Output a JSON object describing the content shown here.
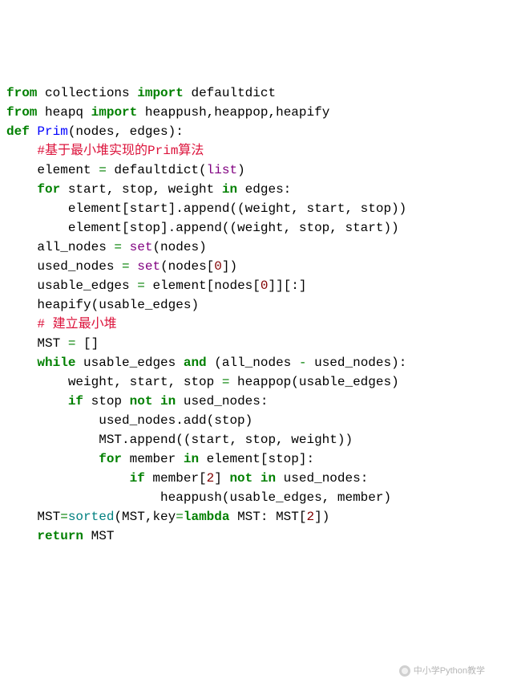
{
  "code": {
    "l1": {
      "from": "from",
      "mod1": "collections",
      "import": "import",
      "name1": "defaultdict"
    },
    "l2": {
      "from": "from",
      "mod2": "heapq",
      "import": "import",
      "names": "heappush,heappop,heapify"
    },
    "l3": {
      "def": "def",
      "fn": "Prim",
      "params": "(nodes, edges):"
    },
    "l4": {
      "cmt": "#基于最小堆实现的Prim算法"
    },
    "l5": {
      "a": "element ",
      "eq": "=",
      "sp": " defaultdict(",
      "bi": "list",
      "c": ")"
    },
    "l6": {
      "for": "for",
      "vars": " start, stop, weight ",
      "in": "in",
      "tail": " edges:"
    },
    "l7": {
      "txt": "element[start].append((weight, start, stop))"
    },
    "l8": {
      "txt": "element[stop].append((weight, stop, start))"
    },
    "l9": {
      "a": "all_nodes ",
      "eq": "=",
      "sp": " ",
      "bi": "set",
      "c": "(nodes)"
    },
    "l10": {
      "a": "used_nodes ",
      "eq": "=",
      "sp": " ",
      "bi": "set",
      "c": "(nodes[",
      "n": "0",
      "d": "])"
    },
    "l11": {
      "a": "usable_edges ",
      "eq": "=",
      "b": " element[nodes[",
      "n": "0",
      "c": "]][:]"
    },
    "l12": {
      "txt": "heapify(usable_edges)"
    },
    "l13": {
      "cmt": "# 建立最小堆"
    },
    "l14": {
      "a": "MST ",
      "eq": "=",
      "b": " []"
    },
    "l15": {
      "while": "while",
      "a": " usable_edges ",
      "and": "and",
      "b": " (all_nodes ",
      "minus": "-",
      "c": " used_nodes):"
    },
    "l16": {
      "a": "weight, start, stop ",
      "eq": "=",
      "b": " heappop(usable_edges)"
    },
    "l17": {
      "if": "if",
      "a": " stop ",
      "not": "not",
      "sp": " ",
      "in": "in",
      "b": " used_nodes:"
    },
    "l18": {
      "txt": "used_nodes.add(stop)"
    },
    "l19": {
      "txt": "MST.append((start, stop, weight))"
    },
    "l20": {
      "for": "for",
      "a": " member ",
      "in": "in",
      "b": " element[stop]:"
    },
    "l21": {
      "if": "if",
      "a": " member[",
      "n": "2",
      "b": "] ",
      "not": "not",
      "sp": " ",
      "in": "in",
      "c": " used_nodes:"
    },
    "l22": {
      "txt": "heappush(usable_edges, member)"
    },
    "l23": {
      "a": "MST",
      "eq": "=",
      "b": "sorted",
      "c": "(MST,key",
      "eq2": "=",
      "lambda": "lambda",
      "d": " MST: MST[",
      "n": "2",
      "e": "])"
    },
    "l24": {
      "return": "return",
      "a": " MST"
    }
  },
  "watermark": "中小学Python教学"
}
